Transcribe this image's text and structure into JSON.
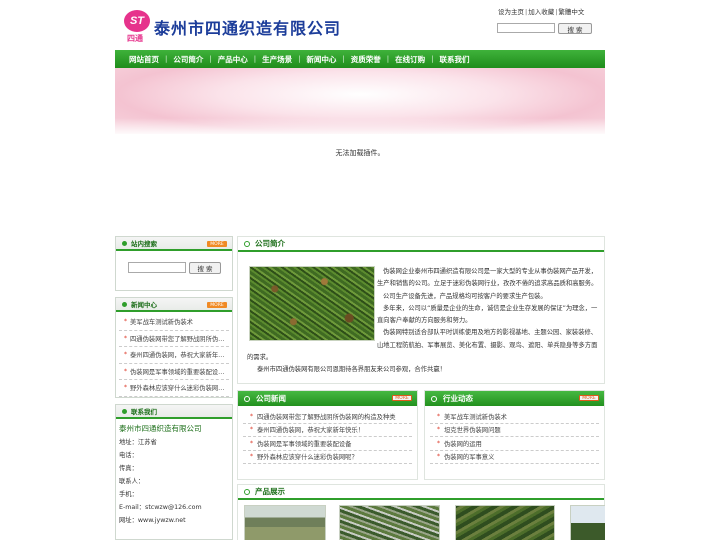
{
  "header": {
    "logo_mark": "ST",
    "logo_sub": "四通",
    "company_name": "泰州市四通织造有限公司",
    "top_links": [
      "设为主页",
      "加入收藏",
      "繁體中文"
    ],
    "search_button": "搜 索"
  },
  "nav": {
    "items": [
      "网站首页",
      "公司简介",
      "产品中心",
      "生产场景",
      "新闻中心",
      "资质荣誉",
      "在线订购",
      "联系我们"
    ]
  },
  "banner": {
    "plugin_message": "无法加载插件。"
  },
  "sidebar": {
    "search": {
      "title": "站内搜索",
      "button": "搜 索"
    },
    "news": {
      "title": "新闻中心",
      "items": [
        "美军战车测试新伪装术",
        "四通伪装网带您了解野战阴所伪…",
        "泰州四通伪装网，恭祝大家新年…",
        "伪装网是军事领域的重要装配设…",
        "野外森林应该穿什么迷彩伪装网…"
      ]
    },
    "contact": {
      "title": "联系我们",
      "company": "泰州市四通织造有限公司",
      "lines": [
        "地址：江苏省",
        "电话：",
        "传真：",
        "联系人：",
        "手机：",
        "E-mail：stcwzw@126.com",
        "网址：www.jywzw.net"
      ]
    },
    "more_label": "MORE"
  },
  "main": {
    "intro": {
      "title": "公司简介",
      "paragraphs": [
        "伪装网企业泰州市四通织造有限公司是一家大型的专业从事伪装网产品开发，生产和销售的公司。立足于迷彩伪装网行业，孜孜不倦的追求高品质和高服务。",
        "公司生产设备先进，产品规格均可按客户的要求生产包装。",
        "多年来，公司以“质量是企业的生命，诚信是企业生存发展的保证”为理念，一直向客户奉献的方向服务和努力。",
        "伪装网特别适合部队平时训练使用及地方的影视基地、主题公园、家装装修、山地工程防航拍、军事展览、美化布置、摄影、观鸟、遮阳、单兵隐身等多方面"
      ],
      "tail": "的需求。",
      "closing": "泰州市四通伪装网有限公司恩期待各界朋友来公司参观，合作共赢！"
    },
    "company_news": {
      "title": "公司新闻",
      "items": [
        "四通伪装网带您了解野战阴所伪装网的构造及种类",
        "泰州四通伪装网，恭祝大家新年快乐！",
        "伪装网是军事领域的重要装配设备",
        "野外森林应该穿什么迷彩伪装网呢？"
      ]
    },
    "industry_news": {
      "title": "行业动态",
      "items": [
        "美军战车测试新伪装术",
        "坦克世界伪装网问题",
        "伪装网的运用",
        "伪装网的军事意义"
      ]
    },
    "products": {
      "title": "产品展示"
    }
  }
}
